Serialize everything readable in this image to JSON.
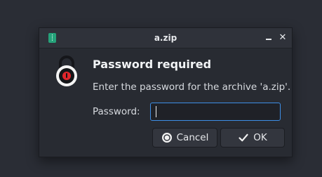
{
  "window": {
    "title": "a.zip",
    "app_icon": "archive-icon",
    "minimize_icon": "minimize-icon",
    "close_icon": "close-icon",
    "close_glyph": "✕"
  },
  "dialog": {
    "icon": "lock-icon",
    "heading": "Password required",
    "message": "Enter the password for the archive 'a.zip'.",
    "password_label": "Password:",
    "password_value": "",
    "password_placeholder": ""
  },
  "buttons": {
    "cancel_label": "Cancel",
    "cancel_icon": "cancel-icon",
    "ok_label": "OK",
    "ok_icon": "checkmark-icon"
  },
  "colors": {
    "focus_ring": "#3d8ee6",
    "accent_lock": "#e0262b",
    "app_icon": "#25a27a"
  }
}
